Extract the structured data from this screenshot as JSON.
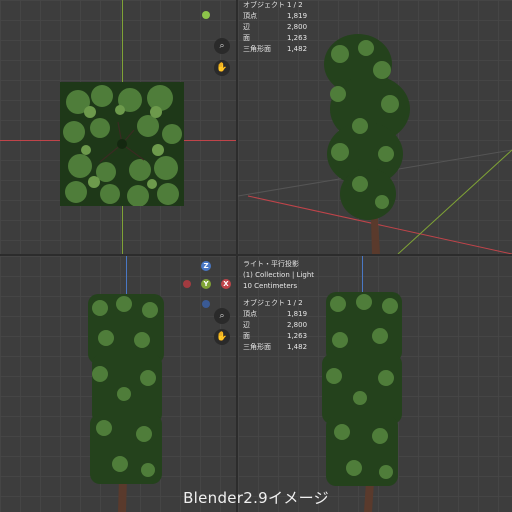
{
  "colors": {
    "background": "#3d3d3d",
    "grid_line": "#464646",
    "x_axis": "#c0444a",
    "y_axis": "#7fa336",
    "z_axis": "#4a78c4",
    "foliage_dark": "#1f3a18",
    "foliage_light": "#4f7d3a",
    "trunk": "#5a3a2c"
  },
  "top_right_view": {
    "stats": [
      {
        "label": "オブジェクト",
        "value": "1 / 2"
      },
      {
        "label": "頂点",
        "value": "1,819"
      },
      {
        "label": "辺",
        "value": "2,800"
      },
      {
        "label": "面",
        "value": "1,263"
      },
      {
        "label": "三角形面",
        "value": "1,482"
      }
    ]
  },
  "bottom_right_view": {
    "view_info": {
      "projection": "ライト・平行投影",
      "collection": "(1) Collection | Light",
      "scale": "10 Centimeters"
    },
    "stats": [
      {
        "label": "オブジェクト",
        "value": "1 / 2"
      },
      {
        "label": "頂点",
        "value": "1,819"
      },
      {
        "label": "辺",
        "value": "2,800"
      },
      {
        "label": "面",
        "value": "1,263"
      },
      {
        "label": "三角形面",
        "value": "1,482"
      }
    ]
  },
  "gizmo": {
    "z": "Z",
    "y": "Y",
    "x": "X"
  },
  "icons": {
    "zoom": "magnifier-icon",
    "pan": "hand-icon"
  },
  "caption": "Blender2.9イメージ"
}
